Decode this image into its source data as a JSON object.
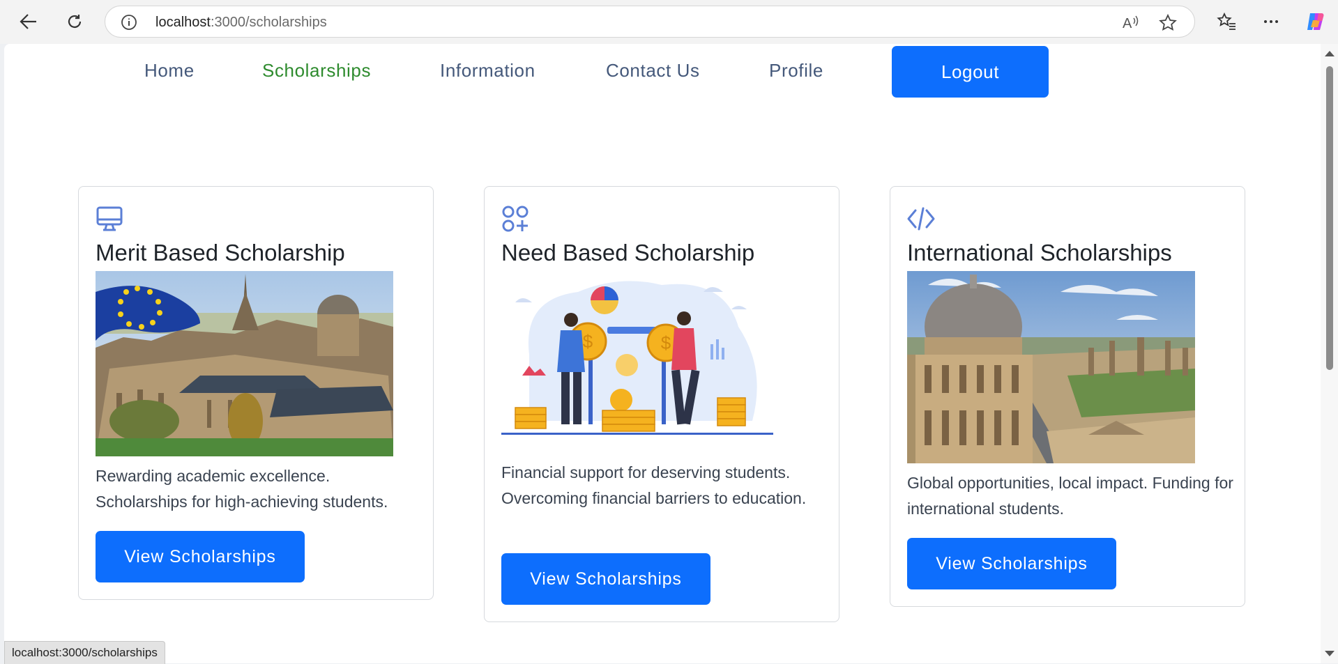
{
  "browser": {
    "url_host": "localhost",
    "url_path": ":3000/scholarships"
  },
  "nav": {
    "items": [
      {
        "label": "Home",
        "active": false
      },
      {
        "label": "Scholarships",
        "active": true
      },
      {
        "label": "Information",
        "active": false
      },
      {
        "label": "Contact Us",
        "active": false
      },
      {
        "label": "Profile",
        "active": false
      }
    ],
    "logout_label": "Logout"
  },
  "cards": [
    {
      "icon": "monitor-icon",
      "title": "Merit Based Scholarship",
      "image": "university-with-eu-flag-photo",
      "description": "Rewarding academic excellence. Scholarships for high-achieving students.",
      "button": "View Scholarships"
    },
    {
      "icon": "apps-grid-plus-icon",
      "title": "Need Based Scholarship",
      "image": "financial-support-illustration",
      "description": "Financial support for deserving students. Overcoming financial barriers to education.",
      "button": "View Scholarships"
    },
    {
      "icon": "code-icon",
      "title": "International Scholarships",
      "image": "radcliffe-camera-oxford-photo",
      "description": "Global opportunities, local impact. Funding for international students.",
      "button": "View Scholarships"
    }
  ],
  "status_bar": "localhost:3000/scholarships",
  "colors": {
    "primary": "#0d6efd",
    "nav_text": "#44587a",
    "nav_active": "#2e8b2e",
    "icon": "#5b7fd6"
  }
}
